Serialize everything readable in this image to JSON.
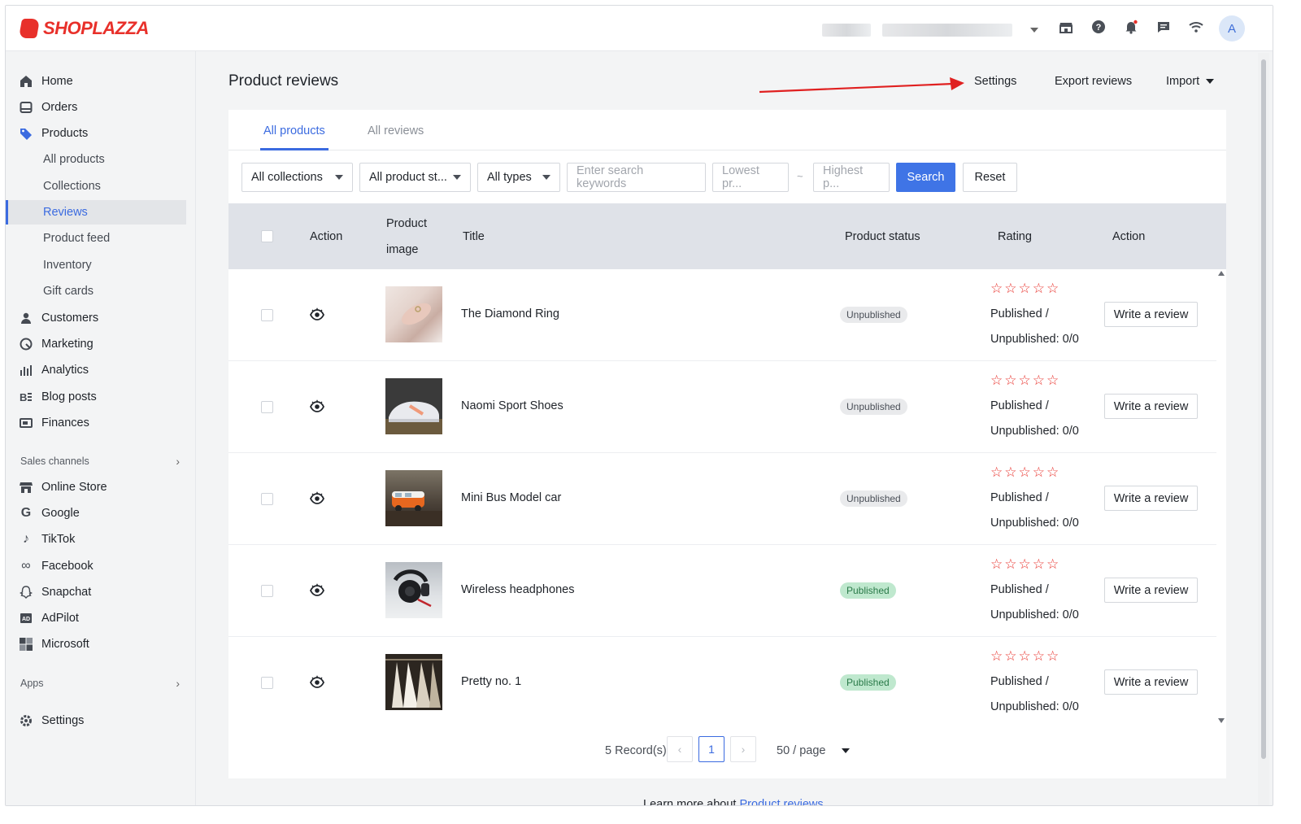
{
  "brand": {
    "name": "SHOPLAZZA",
    "color": "#e8302a"
  },
  "topbar": {
    "icons": [
      "store-icon",
      "help-icon",
      "notification-bell-icon",
      "message-icon",
      "wifi-icon"
    ],
    "avatar_letter": "A"
  },
  "sidebar": {
    "items": [
      {
        "label": "Home",
        "icon": "home-icon"
      },
      {
        "label": "Orders",
        "icon": "orders-icon"
      },
      {
        "label": "Products",
        "icon": "tag-icon"
      }
    ],
    "product_sub": [
      {
        "label": "All products"
      },
      {
        "label": "Collections"
      },
      {
        "label": "Reviews",
        "active": true
      },
      {
        "label": "Product feed"
      },
      {
        "label": "Inventory"
      },
      {
        "label": "Gift cards"
      }
    ],
    "items2": [
      {
        "label": "Customers",
        "icon": "person-icon"
      },
      {
        "label": "Marketing",
        "icon": "marketing-icon"
      },
      {
        "label": "Analytics",
        "icon": "bar-chart-icon"
      },
      {
        "label": "Blog posts",
        "icon": "blog-icon"
      },
      {
        "label": "Finances",
        "icon": "finance-icon"
      }
    ],
    "sales_channels_label": "Sales channels",
    "channels": [
      {
        "label": "Online Store",
        "icon": "store-icon"
      },
      {
        "label": "Google",
        "icon": "google-icon"
      },
      {
        "label": "TikTok",
        "icon": "tiktok-icon"
      },
      {
        "label": "Facebook",
        "icon": "meta-icon"
      },
      {
        "label": "Snapchat",
        "icon": "snapchat-icon"
      },
      {
        "label": "AdPilot",
        "icon": "ad-icon"
      },
      {
        "label": "Microsoft",
        "icon": "microsoft-icon"
      }
    ],
    "apps_label": "Apps",
    "settings_label": "Settings"
  },
  "header": {
    "title": "Product reviews",
    "settings": "Settings",
    "export": "Export reviews",
    "import": "Import"
  },
  "tabs": [
    {
      "label": "All products",
      "active": true
    },
    {
      "label": "All reviews",
      "active": false
    }
  ],
  "filters": {
    "collections": "All collections",
    "product_status": "All product st...",
    "types": "All types",
    "search_placeholder": "Enter search keywords",
    "lowest_placeholder": "Lowest pr...",
    "range_separator": "~",
    "highest_placeholder": "Highest p...",
    "search_btn": "Search",
    "reset_btn": "Reset"
  },
  "table": {
    "headers": {
      "action1": "Action",
      "image_line1": "Product",
      "image_line2": "image",
      "title": "Title",
      "status": "Product status",
      "rating": "Rating",
      "action2": "Action"
    },
    "rows": [
      {
        "title": "The Diamond Ring",
        "status": "Unpublished",
        "published": "Published /",
        "unpublished": "Unpublished: 0/0",
        "write": "Write a review",
        "stars": 5
      },
      {
        "title": "Naomi Sport Shoes",
        "status": "Unpublished",
        "published": "Published /",
        "unpublished": "Unpublished: 0/0",
        "write": "Write a review",
        "stars": 5
      },
      {
        "title": "Mini Bus Model car",
        "status": "Unpublished",
        "published": "Published /",
        "unpublished": "Unpublished: 0/0",
        "write": "Write a review",
        "stars": 5
      },
      {
        "title": "Wireless headphones",
        "status": "Published",
        "published": "Published /",
        "unpublished": "Unpublished: 0/0",
        "write": "Write a review",
        "stars": 5
      },
      {
        "title": "Pretty no. 1",
        "status": "Published",
        "published": "Published /",
        "unpublished": "Unpublished: 0/0",
        "write": "Write a review",
        "stars": 5
      }
    ]
  },
  "pagination": {
    "records": "5 Record(s)",
    "current_page": "1",
    "per_page": "50 / page"
  },
  "footer": {
    "learn_prefix": "Learn more about",
    "learn_link": "Product reviews"
  }
}
